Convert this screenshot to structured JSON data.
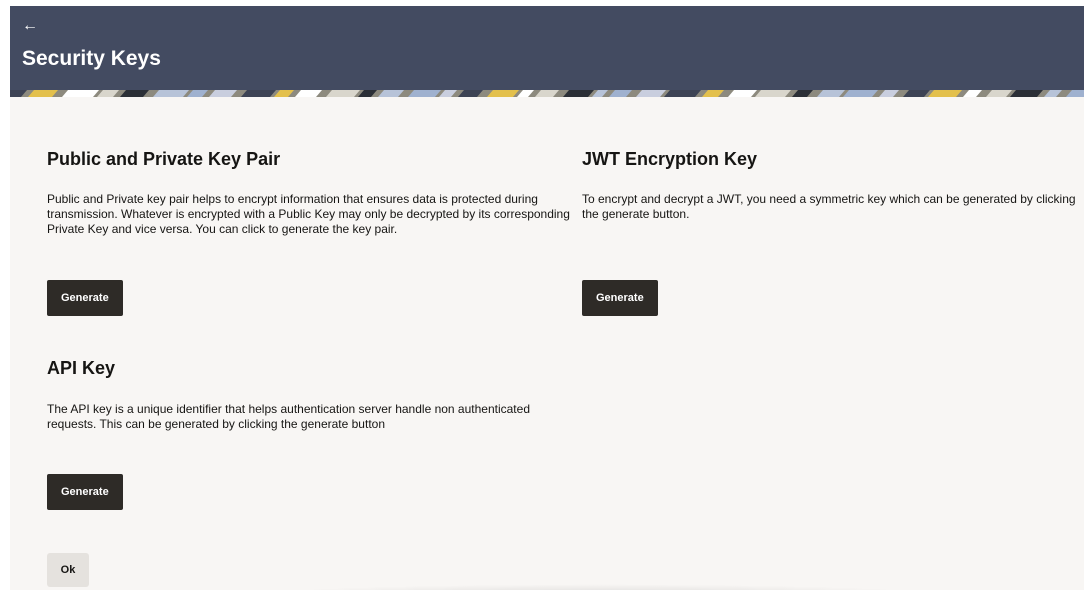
{
  "header": {
    "back_icon": "arrow-left-icon",
    "back_glyph": "←",
    "title": "Security Keys"
  },
  "sections": {
    "key_pair": {
      "heading": "Public and Private Key Pair",
      "description": "Public and Private key pair helps to encrypt information that ensures data is protected during transmission. Whatever is encrypted with a Public Key may only be decrypted by its corresponding Private Key and vice versa. You can click to generate the key pair.",
      "button_label": "Generate"
    },
    "jwt": {
      "heading": "JWT Encryption Key",
      "description": "To encrypt and decrypt a JWT, you need a symmetric key which can be generated by clicking the generate button.",
      "button_label": "Generate"
    },
    "api_key": {
      "heading": "API Key",
      "description": "The API key is a unique identifier that helps authentication server handle non authenticated requests. This can be generated by clicking the generate button",
      "button_label": "Generate"
    }
  },
  "footer": {
    "ok_label": "Ok"
  },
  "colors": {
    "header_bg": "#434b61",
    "content_bg": "#f8f6f4",
    "button_bg": "#2e2b27",
    "ok_button_bg": "#e5e2de"
  }
}
